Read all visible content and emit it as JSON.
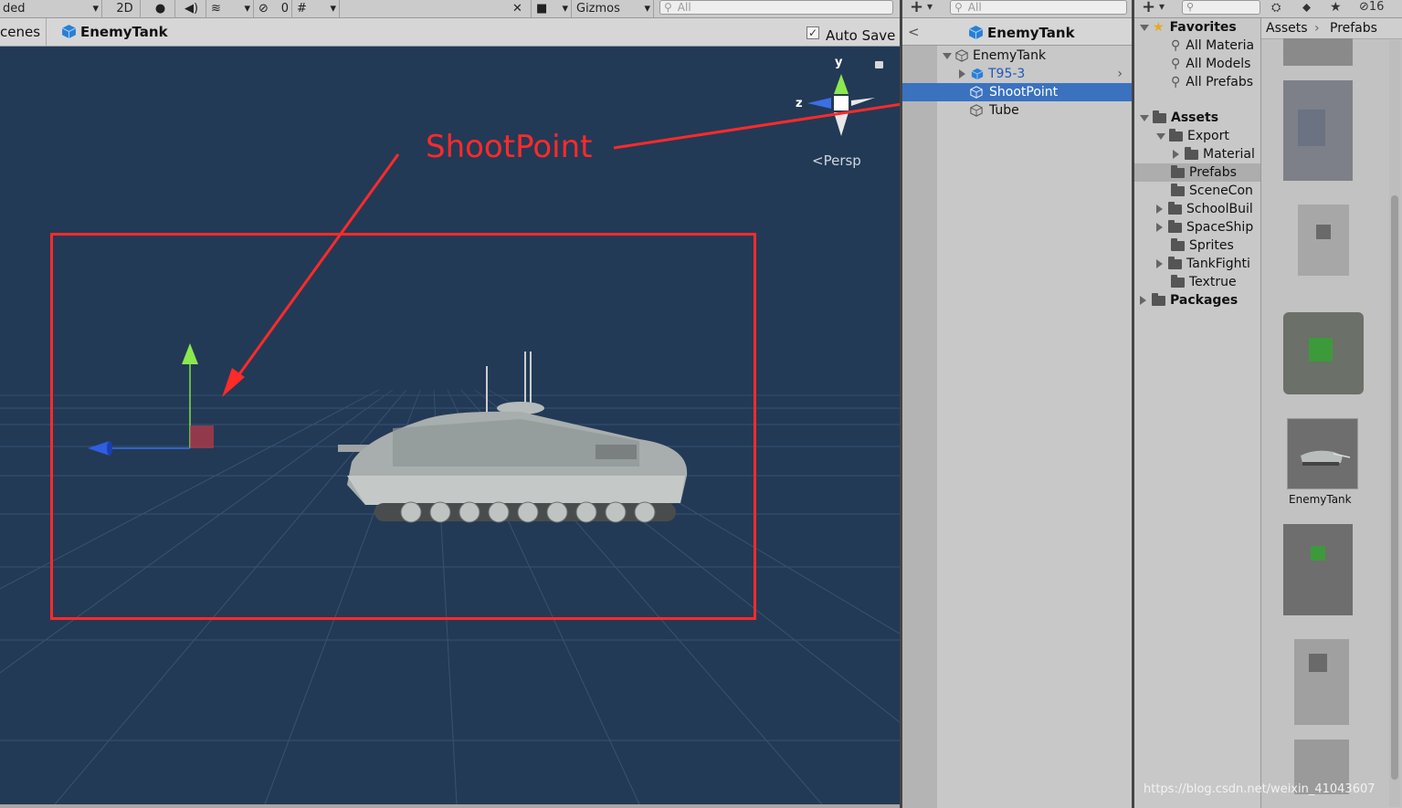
{
  "scene_toolbar": {
    "shading_mode": "ded",
    "mode_2d": "2D",
    "hidden_count": "0",
    "gizmos_label": "Gizmos",
    "search_placeholder": "All"
  },
  "scene_header": {
    "breadcrumb_scenes": "cenes",
    "breadcrumb_prefab": "EnemyTank",
    "auto_save_label": "Auto Save",
    "auto_save_checked": true
  },
  "scene_view": {
    "annotation_text": "ShootPoint",
    "gizmo_y": "y",
    "gizmo_z": "z",
    "projection_label": "Persp",
    "annotation_color": "#ff2a2a",
    "background_color": "#223a56"
  },
  "hierarchy": {
    "search_placeholder": "All",
    "header_title": "EnemyTank",
    "items": [
      {
        "label": "EnemyTank",
        "selected": false
      },
      {
        "label": "T95-3",
        "selected": false
      },
      {
        "label": "ShootPoint",
        "selected": true
      },
      {
        "label": "Tube",
        "selected": false
      }
    ]
  },
  "project": {
    "search_placeholder": "",
    "hidden_count": "16",
    "favorites": {
      "title": "Favorites",
      "items": [
        "All Materia",
        "All Models",
        "All Prefabs"
      ]
    },
    "assets": {
      "title": "Assets",
      "items": [
        {
          "label": "Export"
        },
        {
          "label": "Material"
        },
        {
          "label": "Prefabs",
          "selected": true
        },
        {
          "label": "SceneCon"
        },
        {
          "label": "SchoolBuil"
        },
        {
          "label": "SpaceShip"
        },
        {
          "label": "Sprites"
        },
        {
          "label": "TankFighti"
        },
        {
          "label": "Textrue"
        }
      ]
    },
    "packages": "Packages",
    "breadcrumb_assets": "Assets",
    "breadcrumb_current": "Prefabs",
    "asset_label": "EnemyTank",
    "watermark": "https://blog.csdn.net/weixin_41043607"
  }
}
